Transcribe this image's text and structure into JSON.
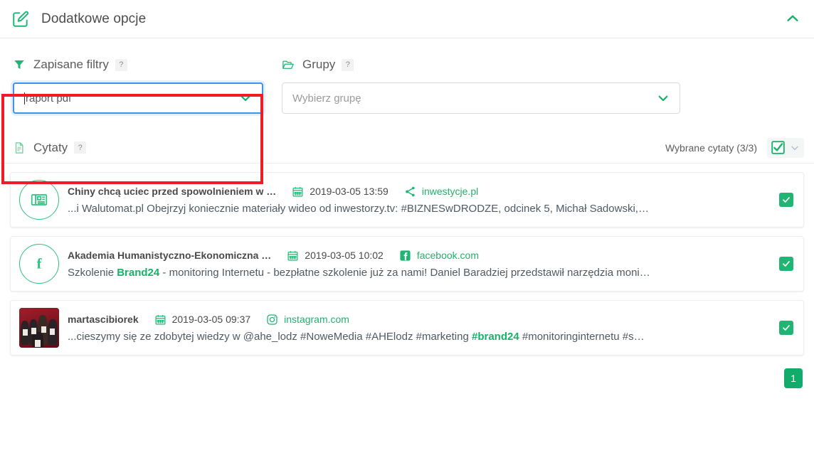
{
  "header": {
    "title": "Dodatkowe opcje",
    "edit_icon": "edit-pencil-icon",
    "collapse_icon": "chevron-up-icon"
  },
  "filters": {
    "saved_filters": {
      "label": "Zapisane filtry",
      "icon": "funnel-filter-icon",
      "help": "?",
      "value": "raport pdf",
      "chevron": "chevron-down-icon"
    },
    "groups": {
      "label": "Grupy",
      "icon": "folder-icon",
      "help": "?",
      "placeholder": "Wybierz grupę",
      "chevron": "chevron-down-icon"
    }
  },
  "quotes": {
    "label": "Cytaty",
    "icon": "document-icon",
    "help": "?",
    "selected_label": "Wybrane cytaty (3/3)",
    "master_checkbox": "checked",
    "master_chevron": "chevron-down-icon",
    "items": [
      {
        "avatar_type": "news-icon",
        "author": "Chiny chcą uciec przed spowolnieniem w …",
        "date": "2019-03-05 13:59",
        "date_icon": "calendar-icon",
        "source": "inwestycje.pl",
        "source_icon": "share-icon",
        "text_parts": [
          {
            "t": "...i Walutomat.pl   Obejrzyj koniecznie materiały wideo od inwestorzy.tv: #BIZNESwDRODZE, odcinek 5, Michał Sadowski,…",
            "hl": false
          }
        ],
        "checked": true
      },
      {
        "avatar_type": "facebook-icon",
        "author": "Akademia Humanistyczno-Ekonomiczna …",
        "date": "2019-03-05 10:02",
        "date_icon": "calendar-icon",
        "source": "facebook.com",
        "source_icon": "facebook-square-icon",
        "text_parts": [
          {
            "t": "Szkolenie ",
            "hl": false
          },
          {
            "t": "Brand24",
            "hl": true
          },
          {
            "t": " - monitoring Internetu - bezpłatne szkolenie już za nami! Daniel Baradziej przedstawił narzędzia moni…",
            "hl": false
          }
        ],
        "checked": true
      },
      {
        "avatar_type": "photo-thumbnail",
        "author": "martascibiorek",
        "date": "2019-03-05 09:37",
        "date_icon": "calendar-icon",
        "source": "instagram.com",
        "source_icon": "instagram-icon",
        "text_parts": [
          {
            "t": "...cieszymy się ze zdobytej wiedzy w @ahe_lodz #NoweMedia #AHElodz #marketing ",
            "hl": false
          },
          {
            "t": "#brand24",
            "hl": true
          },
          {
            "t": " #monitoringinternetu #s…",
            "hl": false
          }
        ],
        "checked": true
      }
    ]
  },
  "pagination": {
    "current_page": "1"
  },
  "colors": {
    "accent_green": "#17b169",
    "highlight_red": "#ef1c25",
    "focus_blue": "#3c93e8",
    "check_green": "#21b573"
  }
}
